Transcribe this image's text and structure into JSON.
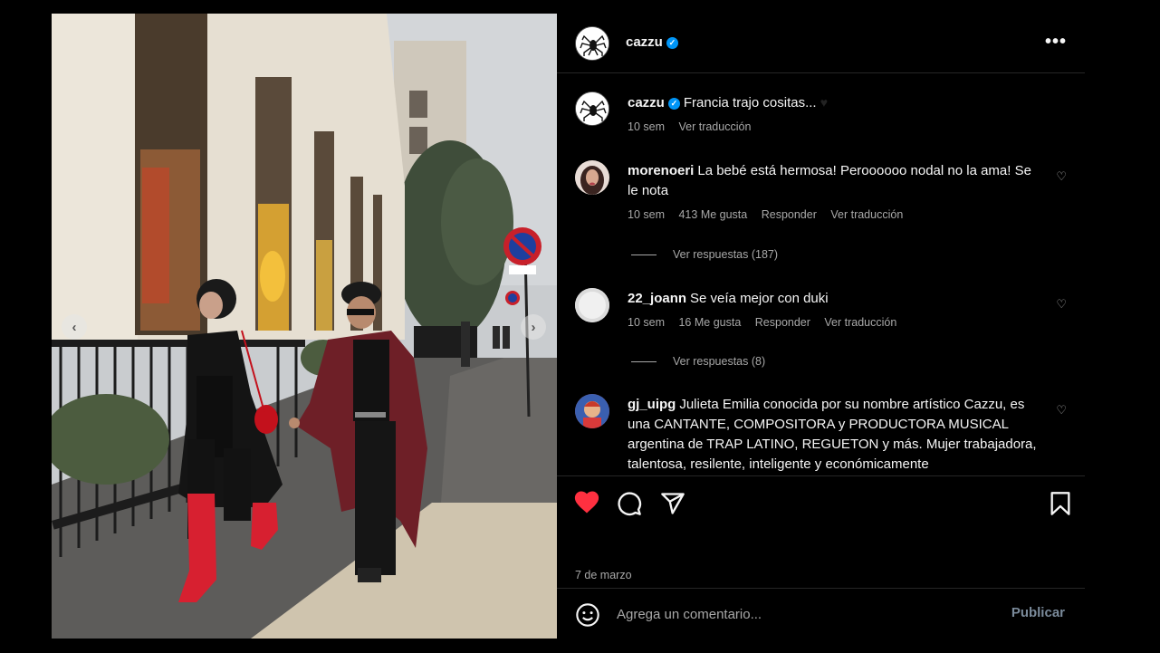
{
  "post": {
    "author": "cazzu",
    "caption": "Francia trajo cositas...",
    "caption_time": "10 sem",
    "caption_translate": "Ver traducción",
    "date": "7 de marzo"
  },
  "comments": [
    {
      "user": "morenoeri",
      "text": "La bebé está hermosa! Peroooooo nodal no la ama! Se le nota",
      "time": "10 sem",
      "likes": "413 Me gusta",
      "reply": "Responder",
      "translate": "Ver traducción",
      "replies": "Ver respuestas (187)"
    },
    {
      "user": "22_joann",
      "text": "Se veía mejor con duki",
      "time": "10 sem",
      "likes": "16 Me gusta",
      "reply": "Responder",
      "translate": "Ver traducción",
      "replies": "Ver respuestas (8)"
    },
    {
      "user": "gj_uipg",
      "text": "Julieta Emilia conocida por su nombre artístico Cazzu, es una CANTANTE, COMPOSITORA y PRODUCTORA MUSICAL argentina de TRAP LATINO, REGUETON y más. Mujer trabajadora, talentosa, resilente, inteligente y económicamente"
    }
  ],
  "add_comment": {
    "placeholder": "Agrega un comentario...",
    "publish_label": "Publicar"
  },
  "colors": {
    "like_red": "#ff3040",
    "verified_blue": "#0095f6",
    "background": "#000000"
  },
  "icons": [
    "spider-logo-icon",
    "verified-icon",
    "more-options-icon",
    "heart-icon",
    "comment-icon",
    "share-icon",
    "bookmark-icon",
    "emoji-icon",
    "chevron-left-icon",
    "chevron-right-icon"
  ]
}
